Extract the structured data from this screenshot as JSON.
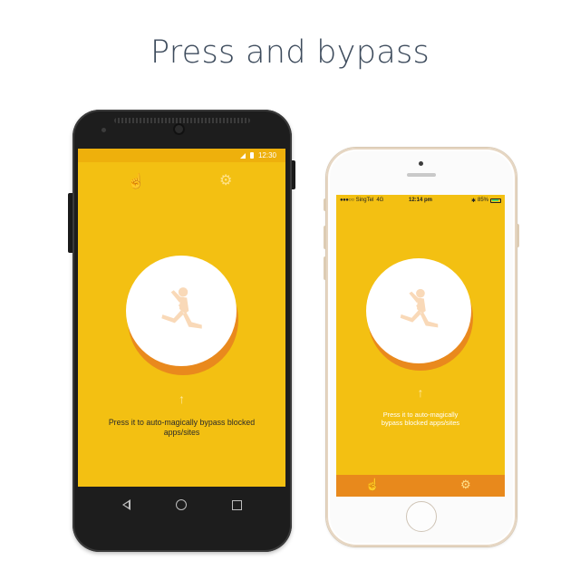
{
  "headline": "Press and bypass",
  "android": {
    "status_time": "12:30",
    "tabs": {
      "hand_icon": "hand-tap-icon",
      "settings_icon": "gear-icon"
    },
    "hint_arrow": "↑",
    "hint_text": "Press it to auto-magically bypass blocked apps/sites",
    "nav": [
      "back",
      "home",
      "recents"
    ]
  },
  "iphone": {
    "status": {
      "signal_dots": "●●●○○",
      "carrier": "SingTel",
      "network": "4G",
      "time": "12:14 pm",
      "bluetooth": "✱",
      "battery_percent": "85%"
    },
    "hint_arrow": "↑",
    "hint_text": "Press it to auto-magically bypass blocked apps/sites",
    "tabs": {
      "hand_icon": "hand-tap-icon",
      "settings_icon": "gear-icon"
    }
  },
  "colors": {
    "screen_bg": "#f3c012",
    "button_shadow": "#e9891d",
    "tabbar": "#e8891c",
    "figure": "#f9d9b8",
    "headline": "#3d4b5c"
  }
}
